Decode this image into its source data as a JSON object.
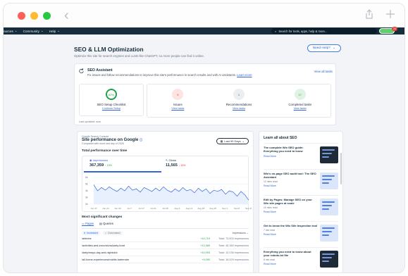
{
  "nav": {
    "items": [
      "ources",
      "Community",
      "Help"
    ],
    "search_placeholder": "Search for tools, apps, help & more...",
    "notif_count": "20"
  },
  "page": {
    "title": "SEO & LLM Optimization",
    "subtitle": "Optimize this site for search engines and LLMs like ChatGPT, so more people can find it online.",
    "help_label": "Need Help?"
  },
  "assistant": {
    "title": "SEO Assistant",
    "desc": "Fix issues and follow recommendations to improve this site's performance in search results and with AI assistants.",
    "learn_more": "Learn more",
    "view_all": "View all tasks",
    "tiles": [
      {
        "value": "62%",
        "label": "SEO Setup Checklist",
        "link": "Continue Setup",
        "color": "#24a148",
        "bg": "#ffffff"
      },
      {
        "value": "9",
        "label": "Issues",
        "link": "View tasks",
        "color": "#d8352b",
        "bg": "#fde3e1"
      },
      {
        "value": "1",
        "label": "Recommendations",
        "link": "View tasks",
        "color": "#485562",
        "bg": "#eceff2"
      },
      {
        "value": "17",
        "label": "Completed tasks",
        "link": "View tasks",
        "color": "#24a148",
        "bg": "#dff3e4"
      }
    ],
    "updated": "Last updated: now"
  },
  "performance": {
    "source": "Google Search Console",
    "title": "Site performance on Google",
    "updated": "Compared with more last day of 2026",
    "date_range": "Last 90 Days",
    "section": "Total performance over time",
    "impressions_label": "Impressions",
    "impressions_value": "367,359",
    "impressions_change": "↑ 13%",
    "clicks_label": "Clicks",
    "clicks_value": "11,565",
    "clicks_change": "↓ 13%"
  },
  "chart_data": {
    "type": "line",
    "x": [
      "Jun 17",
      "Jun 24",
      "Jun 30",
      "Jul 7",
      "Jul 17",
      "Jul 21",
      "Jul 28",
      "Aug 4",
      "Aug 11",
      "Aug 18",
      "Aug 25",
      "Sep 1",
      "Sep 8",
      "Sep 15"
    ],
    "ylabels": [
      "6k",
      "5k",
      "4k",
      "3k",
      "2k"
    ],
    "series": [
      {
        "name": "Impressions",
        "values": [
          4.9,
          4.0,
          4.5,
          4.1,
          4.6,
          4.2,
          3.9,
          4.4,
          4.0,
          4.7,
          4.1,
          4.3,
          3.8,
          4.5,
          4.2,
          3.9,
          4.4,
          4.0,
          4.6,
          4.1,
          3.8,
          4.3,
          3.9,
          4.5,
          4.0,
          4.2,
          3.7,
          4.4,
          3.9,
          4.3,
          3.6,
          4.1,
          3.9,
          4.2,
          3.5,
          4.0,
          3.8,
          3.2,
          3.9,
          3.4,
          2.6
        ]
      }
    ],
    "ylim": [
      2,
      6
    ]
  },
  "changes": {
    "title": "Most significant changes",
    "tabs": [
      "Pages",
      "Queries"
    ],
    "chips": [
      "Increased",
      "Decreased"
    ],
    "metric": "Impressions",
    "rows": [
      {
        "page": "/airbnbs",
        "delta": "+14,719",
        "total": "Total: 73,504 impressions"
      },
      {
        "page": "/activities-and-excursions/party-boat",
        "delta": "+13,369",
        "total": "Total: 45,384 impressions"
      },
      {
        "page": "/daily/mayo-day-and-nightclub",
        "delta": "+10,093",
        "total": "Total: 12,036 impressions"
      },
      {
        "page": "/all-home-experiences/mobile-bartender",
        "delta": "+9,090",
        "total": "Total: 18,529 impressions"
      }
    ]
  },
  "learn": {
    "title": "Learn all about SEO",
    "articles": [
      {
        "title": "The complete Wix SEO guide: Everything you need to know",
        "read": "",
        "cta": "Read More",
        "dark": true
      },
      {
        "title": "Wix's on-page SEO audit tool: The SEO Assistant",
        "read": "12 mins read",
        "cta": "Read More",
        "dark": false
      },
      {
        "title": "Edit by Pages: Manage SEO on your Wix site pages at scale",
        "read": "10 mins read",
        "cta": "Read More",
        "dark": false
      },
      {
        "title": "Get to know the Wix Site Inspection tool",
        "read": "7 min read",
        "cta": "Read More",
        "dark": false
      },
      {
        "title": "Everything you need to know about your robots.txt file",
        "read": "8 min read",
        "cta": "Read More",
        "dark": true
      }
    ]
  }
}
